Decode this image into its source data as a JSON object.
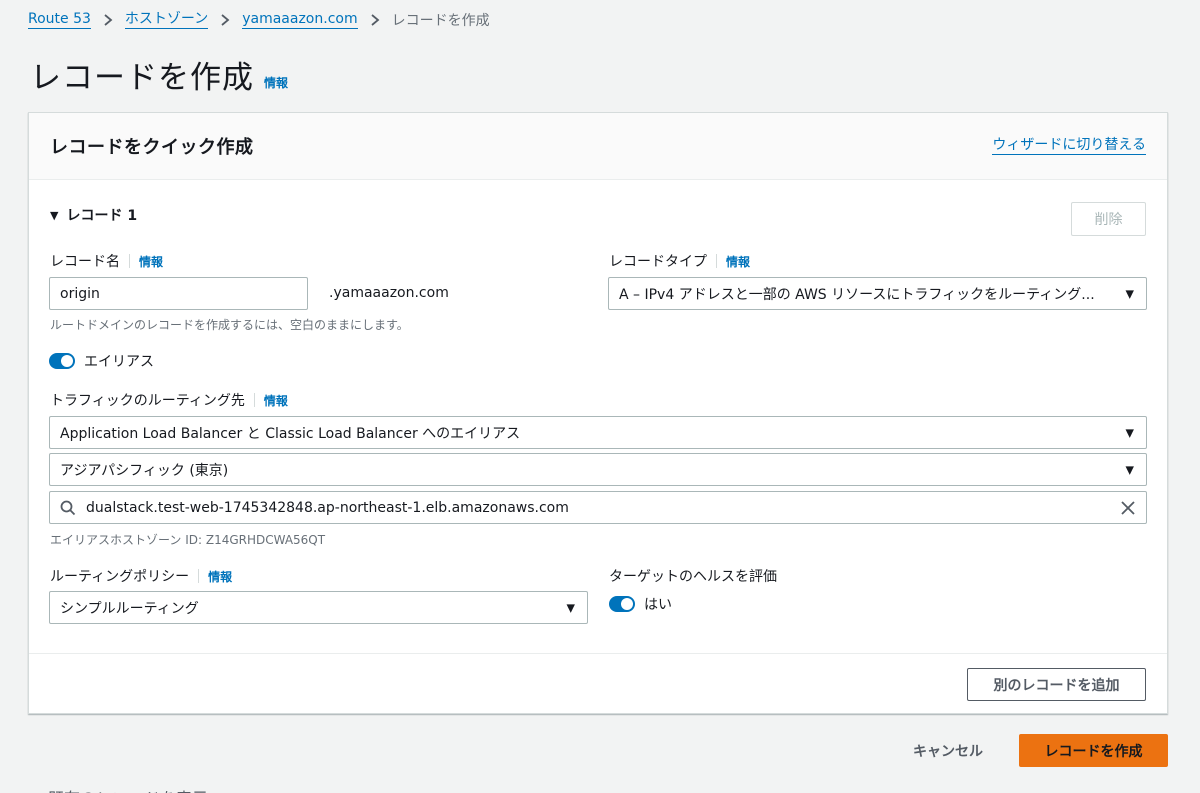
{
  "breadcrumb": {
    "items": [
      "Route 53",
      "ホストゾーン",
      "yamaaazon.com"
    ],
    "current": "レコードを作成"
  },
  "page": {
    "title": "レコードを作成",
    "info": "情報"
  },
  "panel": {
    "title": "レコードをクイック作成",
    "wizard_link": "ウィザードに切り替える",
    "record_heading": "レコード 1",
    "delete_label": "削除",
    "record_name": {
      "label": "レコード名",
      "info": "情報",
      "value": "origin",
      "suffix": ".yamaaazon.com",
      "hint": "ルートドメインのレコードを作成するには、空白のままにします。"
    },
    "record_type": {
      "label": "レコードタイプ",
      "info": "情報",
      "value": "A – IPv4 アドレスと一部の AWS リソースにトラフィックをルーティング..."
    },
    "alias": {
      "label": "エイリアス",
      "enabled": true
    },
    "route_target": {
      "label": "トラフィックのルーティング先",
      "info": "情報",
      "endpoint_type": "Application Load Balancer と Classic Load Balancer へのエイリアス",
      "region": "アジアパシフィック (東京)",
      "endpoint_value": "dualstack.test-web-1745342848.ap-northeast-1.elb.amazonaws.com",
      "hosted_zone_hint": "エイリアスホストゾーン ID: Z14GRHDCWA56QT"
    },
    "routing_policy": {
      "label": "ルーティングポリシー",
      "info": "情報",
      "value": "シンプルルーティング"
    },
    "health": {
      "label": "ターゲットのヘルスを評価",
      "toggle_label": "はい",
      "enabled": true
    },
    "add_record_label": "別のレコードを追加"
  },
  "actions": {
    "cancel_label": "キャンセル",
    "create_label": "レコードを作成"
  },
  "below_fold_text": "既存のレコードを表示",
  "colors": {
    "link": "#0073bb",
    "primary_button": "#ec7211",
    "toggle_on": "#0073bb"
  }
}
